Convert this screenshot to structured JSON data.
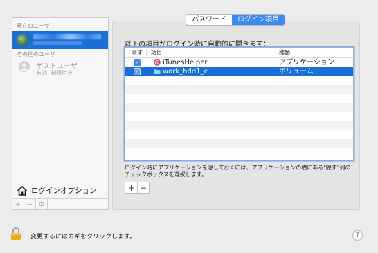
{
  "sidebar": {
    "current_users_label": "現在のユーザ",
    "current_user": {
      "name": "",
      "subtitle": ""
    },
    "other_users_label": "その他のユーザ",
    "guest": {
      "name": "ゲストユーザ",
      "status": "有効, 制限付き"
    },
    "login_options_label": "ログインオプション",
    "toolbar": {
      "add": "+",
      "remove": "−",
      "action": "⚙"
    }
  },
  "tabs": [
    {
      "label": "パスワード",
      "active": false
    },
    {
      "label": "ログイン項目",
      "active": true
    }
  ],
  "intro_text": "以下の項目がログイン時に自動的に開きます：",
  "table": {
    "columns": {
      "hide": "隠す",
      "item": "項目",
      "kind": "種類"
    },
    "rows": [
      {
        "hidden": true,
        "icon": "itunes-helper-icon",
        "name": "iTunesHelper",
        "kind": "アプリケーション",
        "selected": false
      },
      {
        "hidden": true,
        "icon": "folder-icon",
        "name": "work_hdd1_c",
        "kind": "ボリューム",
        "selected": true
      }
    ]
  },
  "note_text": "ログイン時にアプリケーションを隠しておくには、アプリケーションの横にある\"隠す\"列のチェックボックスを選択します。",
  "table_buttons": {
    "add": "+",
    "remove": "−"
  },
  "lock_text": "変更するにはカギをクリックします。",
  "help_label": "?",
  "colors": {
    "selection": "#1a6fd6",
    "accent": "#3c8bf5",
    "window_bg": "#ececec"
  }
}
